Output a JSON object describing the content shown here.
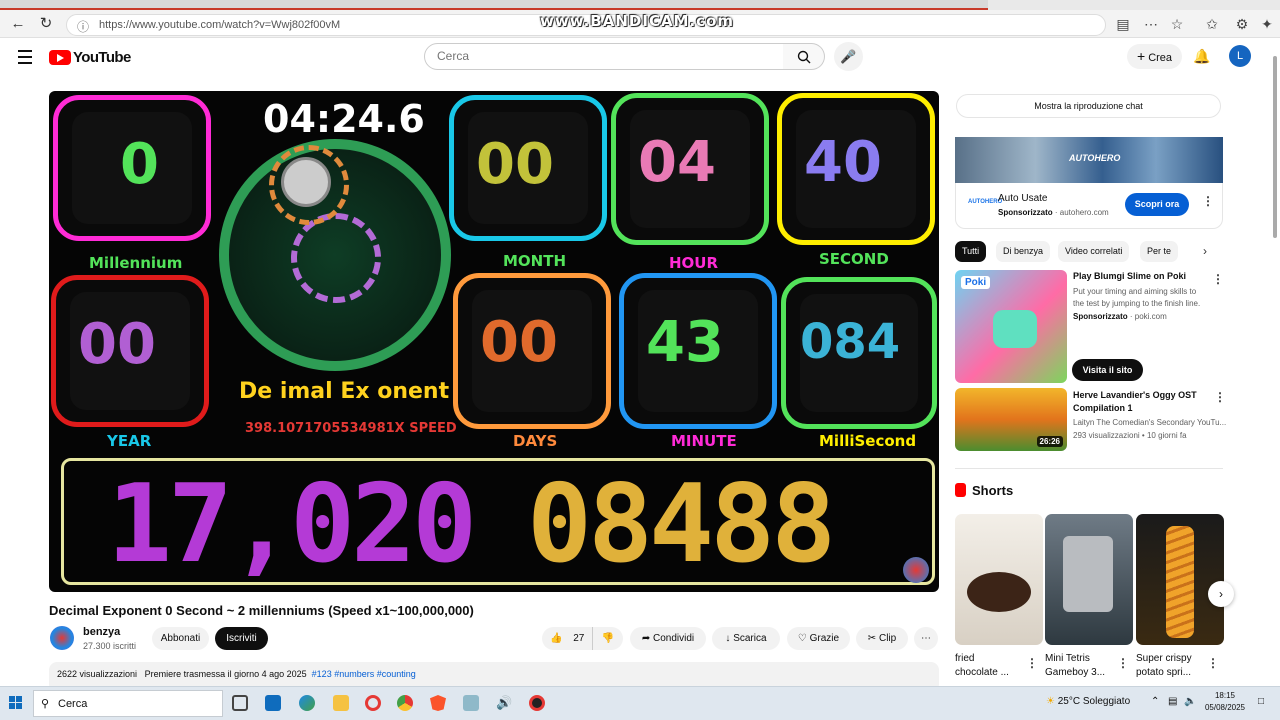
{
  "browser": {
    "url": "https://www.youtube.com/watch?v=Wwj802f00vM",
    "watermark": "www.BANDICAM.com"
  },
  "header": {
    "logo_text": "YouTube",
    "search_placeholder": "Cerca",
    "create_label": "Crea",
    "avatar_letter": "L"
  },
  "video_frame": {
    "timer": "04:24.6",
    "panels": [
      {
        "label": "Millennium",
        "digits": "0",
        "color": "#ff2bd6",
        "label_color": "#53e35a"
      },
      {
        "label": "MONTH",
        "digits": "00",
        "color": "#19c8e8",
        "label_color": "#53e35a"
      },
      {
        "label": "HOUR",
        "digits": "04",
        "color": "#53e35a",
        "label_color": "#ff2bd6"
      },
      {
        "label": "SECOND",
        "digits": "40",
        "color": "#ffee00",
        "label_color": "#53e35a"
      },
      {
        "label": "YEAR",
        "digits": "00",
        "color": "#e01b1b",
        "label_color": "#19c8e8"
      },
      {
        "label": "DAYS",
        "digits": "00",
        "color": "#ff9a3c",
        "label_color": "#ff8a3c"
      },
      {
        "label": "MINUTE",
        "digits": "43",
        "color": "#2196f3",
        "label_color": "#ff2bd6"
      },
      {
        "label": "MilliSecond",
        "digits": "084",
        "color": "#53e35a",
        "label_color": "#ffee00"
      }
    ],
    "title_overlay": "De imal Ex onent",
    "speed_overlay": "398.1071705534981X SPEED",
    "counter_left": "17,020",
    "counter_right": "08488"
  },
  "video_info": {
    "title": "Decimal Exponent 0 Second ~ 2 millenniums (Speed x1~100,000,000)",
    "channel": "benzya",
    "subscribers": "27.300 iscritti",
    "subscribed_label": "Abbonati",
    "subscribe_label": "Iscriviti",
    "likes": "27",
    "share_label": "Condividi",
    "download_label": "Scarica",
    "thanks_label": "Grazie",
    "clip_label": "Clip",
    "views": "2622 visualizzazioni",
    "premiere": "Premiere trasmessa il giorno 4 ago 2025",
    "tags": "#123 #numbers #counting"
  },
  "sidebar": {
    "chat_label": "Mostra la riproduzione chat",
    "ad": {
      "brand": "AUTOHERO",
      "logo": "AUTOHERO",
      "title": "Auto Usate",
      "sponsored": "Sponsorizzato",
      "domain": "autohero.com",
      "cta": "Scopri ora"
    },
    "chips": [
      "Tutti",
      "Di benzya",
      "Video correlati",
      "Per te"
    ],
    "items": [
      {
        "title": "Play Blumgi Slime on Poki",
        "desc1": "Put your timing and aiming skills to",
        "desc2": "the test by jumping to the finish line.",
        "sponsored": "Sponsorizzato",
        "domain": "poki.com",
        "cta": "Visita il sito",
        "thumb_logo": "Poki"
      },
      {
        "title1": "Herve Lavandier's Oggy OST",
        "title2": "Compilation 1",
        "channel": "Laityn The Comedian's Secondary YouTu...",
        "meta": "293 visualizzazioni • 10 giorni fa",
        "duration": "26:26"
      }
    ],
    "shorts_label": "Shorts",
    "shorts": [
      {
        "t1": "fried",
        "t2": "chocolate ..."
      },
      {
        "t1": "Mini Tetris",
        "t2": "Gameboy 3..."
      },
      {
        "t1": "Super crispy",
        "t2": "potato spri..."
      }
    ]
  },
  "taskbar": {
    "search": "Cerca",
    "weather": "25°C  Soleggiato",
    "time": "18:15",
    "date": "05/08/2025"
  }
}
